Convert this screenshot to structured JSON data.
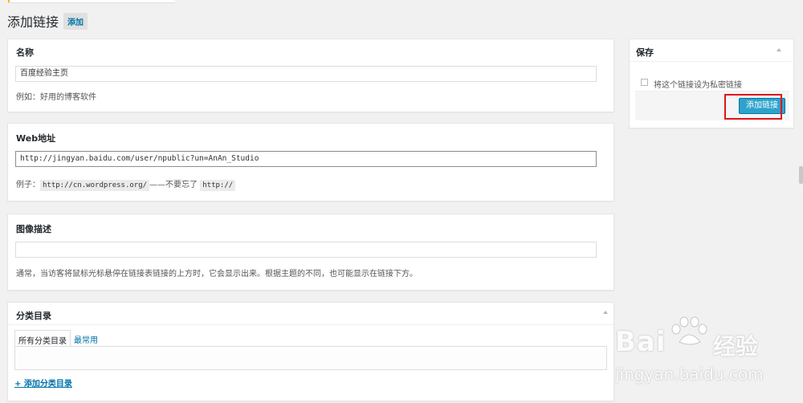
{
  "page": {
    "title": "添加链接",
    "add_new_label": "添加"
  },
  "name_box": {
    "title": "名称",
    "value": "百度经验主页",
    "hint": "例如：好用的博客软件"
  },
  "web_box": {
    "title": "Web地址",
    "value": "http://jingyan.baidu.com/user/npublic?un=AnAn_Studio",
    "hint_prefix": "例子：",
    "hint_code1": "http://cn.wordpress.org/",
    "hint_middle": "——不要忘了",
    "hint_code2": "http://"
  },
  "desc_box": {
    "title": "图像描述",
    "value": "",
    "hint": "通常，当访客将鼠标光标悬停在链接表链接的上方时，它会显示出来。根据主题的不同，也可能显示在链接下方。"
  },
  "category_box": {
    "title": "分类目录",
    "tab_all": "所有分类目录",
    "tab_common": "最常用",
    "add_label": "+ 添加分类目录"
  },
  "save_box": {
    "title": "保存",
    "private_label": "将这个链接设为私密链接",
    "submit_label": "添加链接"
  },
  "watermark": {
    "brand": "Bai",
    "brand_cn": "经验",
    "url": "jingyan.baidu.com"
  },
  "colors": {
    "primary": "#2ea2cc",
    "link": "#0073aa",
    "highlight": "#e0141c",
    "background": "#f1f1f1"
  }
}
